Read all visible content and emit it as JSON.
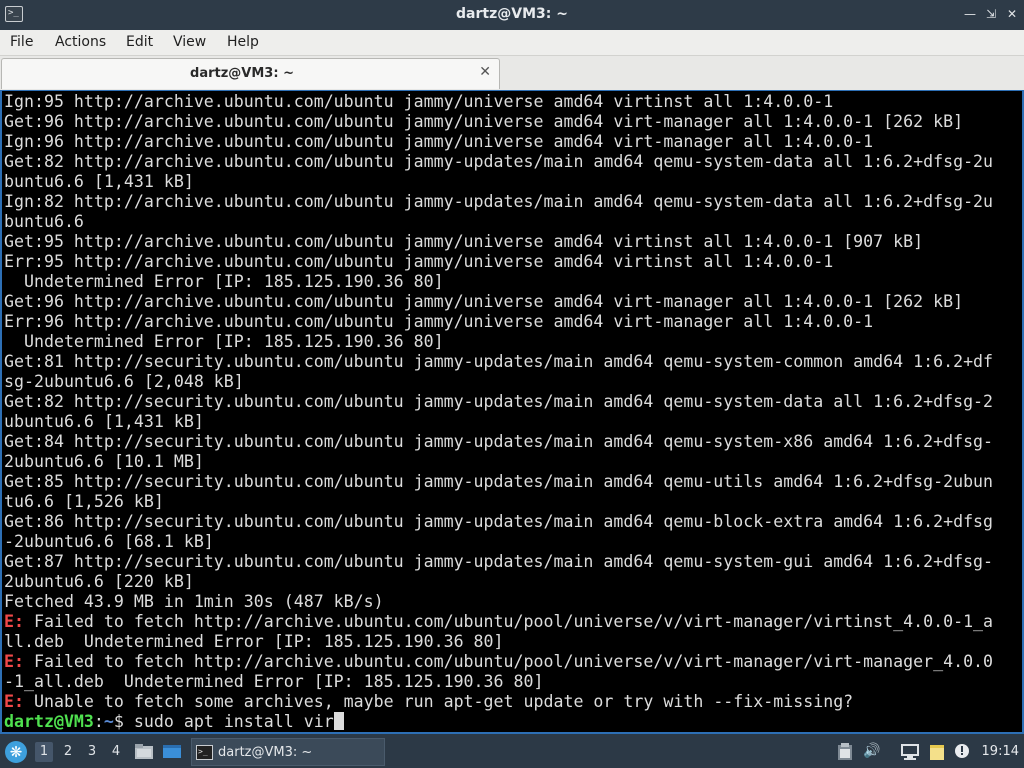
{
  "window": {
    "title": "dartz@VM3: ~",
    "icon": "terminal-icon"
  },
  "menu": [
    "File",
    "Actions",
    "Edit",
    "View",
    "Help"
  ],
  "tab": {
    "label": "dartz@VM3: ~"
  },
  "terminal": {
    "lines": [
      {
        "text": "Ign:95 http://archive.ubuntu.com/ubuntu jammy/universe amd64 virtinst all 1:4.0.0-1"
      },
      {
        "text": "Get:96 http://archive.ubuntu.com/ubuntu jammy/universe amd64 virt-manager all 1:4.0.0-1 [262 kB]"
      },
      {
        "text": "Ign:96 http://archive.ubuntu.com/ubuntu jammy/universe amd64 virt-manager all 1:4.0.0-1"
      },
      {
        "text": "Get:82 http://archive.ubuntu.com/ubuntu jammy-updates/main amd64 qemu-system-data all 1:6.2+dfsg-2u"
      },
      {
        "text": "buntu6.6 [1,431 kB]"
      },
      {
        "text": "Ign:82 http://archive.ubuntu.com/ubuntu jammy-updates/main amd64 qemu-system-data all 1:6.2+dfsg-2u"
      },
      {
        "text": "buntu6.6"
      },
      {
        "text": "Get:95 http://archive.ubuntu.com/ubuntu jammy/universe amd64 virtinst all 1:4.0.0-1 [907 kB]"
      },
      {
        "text": "Err:95 http://archive.ubuntu.com/ubuntu jammy/universe amd64 virtinst all 1:4.0.0-1"
      },
      {
        "text": "  Undetermined Error [IP: 185.125.190.36 80]"
      },
      {
        "text": "Get:96 http://archive.ubuntu.com/ubuntu jammy/universe amd64 virt-manager all 1:4.0.0-1 [262 kB]"
      },
      {
        "text": "Err:96 http://archive.ubuntu.com/ubuntu jammy/universe amd64 virt-manager all 1:4.0.0-1"
      },
      {
        "text": "  Undetermined Error [IP: 185.125.190.36 80]"
      },
      {
        "text": "Get:81 http://security.ubuntu.com/ubuntu jammy-updates/main amd64 qemu-system-common amd64 1:6.2+df"
      },
      {
        "text": "sg-2ubuntu6.6 [2,048 kB]"
      },
      {
        "text": "Get:82 http://security.ubuntu.com/ubuntu jammy-updates/main amd64 qemu-system-data all 1:6.2+dfsg-2"
      },
      {
        "text": "ubuntu6.6 [1,431 kB]"
      },
      {
        "text": "Get:84 http://security.ubuntu.com/ubuntu jammy-updates/main amd64 qemu-system-x86 amd64 1:6.2+dfsg-"
      },
      {
        "text": "2ubuntu6.6 [10.1 MB]"
      },
      {
        "text": "Get:85 http://security.ubuntu.com/ubuntu jammy-updates/main amd64 qemu-utils amd64 1:6.2+dfsg-2ubun"
      },
      {
        "text": "tu6.6 [1,526 kB]"
      },
      {
        "text": "Get:86 http://security.ubuntu.com/ubuntu jammy-updates/main amd64 qemu-block-extra amd64 1:6.2+dfsg"
      },
      {
        "text": "-2ubuntu6.6 [68.1 kB]"
      },
      {
        "text": "Get:87 http://security.ubuntu.com/ubuntu jammy-updates/main amd64 qemu-system-gui amd64 1:6.2+dfsg-"
      },
      {
        "text": "2ubuntu6.6 [220 kB]"
      },
      {
        "text": "Fetched 43.9 MB in 1min 30s (487 kB/s)"
      },
      {
        "prefix": "E:",
        "text": " Failed to fetch http://archive.ubuntu.com/ubuntu/pool/universe/v/virt-manager/virtinst_4.0.0-1_a"
      },
      {
        "text": "ll.deb  Undetermined Error [IP: 185.125.190.36 80]"
      },
      {
        "prefix": "E:",
        "text": " Failed to fetch http://archive.ubuntu.com/ubuntu/pool/universe/v/virt-manager/virt-manager_4.0.0"
      },
      {
        "text": "-1_all.deb  Undetermined Error [IP: 185.125.190.36 80]"
      },
      {
        "prefix": "E:",
        "text": " Unable to fetch some archives, maybe run apt-get update or try with --fix-missing?"
      }
    ],
    "prompt": {
      "user": "dartz@VM3",
      "sep": ":",
      "path": "~",
      "symbol": "$ ",
      "command": "sudo apt install vir"
    }
  },
  "panel": {
    "workspaces": [
      "1",
      "2",
      "3",
      "4"
    ],
    "active_workspace": "1",
    "task_label": "dartz@VM3: ~",
    "clock": "19:14",
    "colors": {
      "accent": "#2d6fb5",
      "panel": "#2c3946",
      "error": "#f04848",
      "prompt_user": "#4fe14f",
      "prompt_path": "#5a8bd6"
    }
  }
}
